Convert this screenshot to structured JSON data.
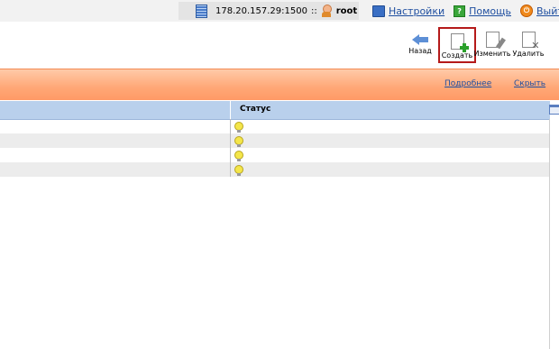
{
  "topbar": {
    "server_address": "178.20.157.29:1500",
    "separator": "::",
    "user": "root",
    "links": [
      {
        "label": "Настройки",
        "icon": "settings-icon"
      },
      {
        "label": "Помощь",
        "icon": "help-icon"
      },
      {
        "label": "Выйти",
        "icon": "exit-icon"
      }
    ]
  },
  "toolbar": {
    "back_label": "Назад",
    "create_label": "Создать",
    "edit_label": "Изменить",
    "delete_label": "Удалить"
  },
  "band": {
    "more_label": "Подробнее",
    "hide_label": "Скрыть"
  },
  "table": {
    "columns": [
      "",
      "Статус"
    ],
    "rows": [
      {
        "status_icon": "bulb-icon"
      },
      {
        "status_icon": "bulb-icon"
      },
      {
        "status_icon": "bulb-icon"
      },
      {
        "status_icon": "bulb-icon"
      }
    ]
  },
  "colors": {
    "accent_link": "#1f4fa0",
    "band": "#ffa776",
    "header": "#b9d0ec",
    "highlight_border": "#b51a1a"
  }
}
